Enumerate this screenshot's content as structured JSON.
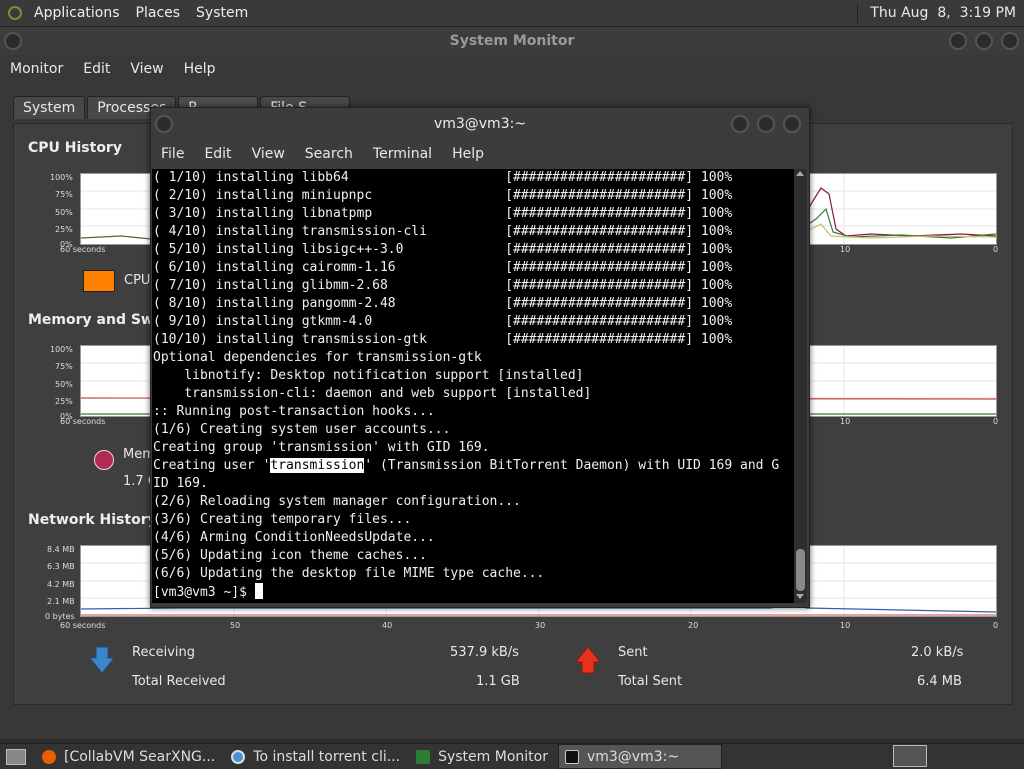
{
  "top_panel": {
    "menus": [
      "Applications",
      "Places",
      "System"
    ],
    "clock": "Thu Aug  8,  3:19 PM"
  },
  "sysmon": {
    "title": "System Monitor",
    "menu": [
      "Monitor",
      "Edit",
      "View",
      "Help"
    ],
    "tabs": [
      "System",
      "Processes",
      "R",
      "File S"
    ],
    "cpu": {
      "title": "CPU History",
      "y_ticks": [
        "100%",
        "75%",
        "50%",
        "25%",
        "0%"
      ],
      "x_start": "60 seconds",
      "x_visible": [
        "10",
        "0"
      ],
      "legend": "CPU"
    },
    "memory": {
      "title": "Memory and Swap H",
      "y_ticks": [
        "100%",
        "75%",
        "50%",
        "25%",
        "0%"
      ],
      "x_start": "60 seconds",
      "x_visible": [
        "10",
        "0"
      ],
      "legend_label": "Mem",
      "legend_value": "1.7 G"
    },
    "network": {
      "title": "Network History",
      "y_ticks": [
        "8.4 MB",
        "6.3 MB",
        "4.2 MB",
        "2.1 MB",
        "0 bytes"
      ],
      "x_ticks": [
        "60 seconds",
        "50",
        "40",
        "30",
        "20",
        "10",
        "0"
      ],
      "receiving_label": "Receiving",
      "receiving_value": "537.9 kB/s",
      "total_received_label": "Total Received",
      "total_received_value": "1.1 GB",
      "sent_label": "Sent",
      "sent_value": "2.0 kB/s",
      "total_sent_label": "Total Sent",
      "total_sent_value": "6.4 MB"
    }
  },
  "terminal": {
    "title": "vm3@vm3:~",
    "menu": [
      "File",
      "Edit",
      "View",
      "Search",
      "Terminal",
      "Help"
    ],
    "lines": [
      "( 1/10) installing libb64                    [######################] 100%",
      "( 2/10) installing miniupnpc                 [######################] 100%",
      "( 3/10) installing libnatpmp                 [######################] 100%",
      "( 4/10) installing transmission-cli          [######################] 100%",
      "( 5/10) installing libsigc++-3.0             [######################] 100%",
      "( 6/10) installing cairomm-1.16              [######################] 100%",
      "( 7/10) installing glibmm-2.68               [######################] 100%",
      "( 8/10) installing pangomm-2.48              [######################] 100%",
      "( 9/10) installing gtkmm-4.0                 [######################] 100%",
      "(10/10) installing transmission-gtk          [######################] 100%",
      "Optional dependencies for transmission-gtk",
      "    libnotify: Desktop notification support [installed]",
      "    transmission-cli: daemon and web support [installed]",
      ":: Running post-transaction hooks...",
      "(1/6) Creating system user accounts...",
      "Creating group 'transmission' with GID 169."
    ],
    "user_line_prefix": "Creating user '",
    "user_line_highlight": "transmission",
    "user_line_suffix": "' (Transmission BitTorrent Daemon) with UID 169 and G",
    "lines2": [
      "ID 169.",
      "(2/6) Reloading system manager configuration...",
      "(3/6) Creating temporary files...",
      "(4/6) Arming ConditionNeedsUpdate...",
      "(5/6) Updating icon theme caches...",
      "(6/6) Updating the desktop file MIME type cache..."
    ],
    "prompt": "[vm3@vm3 ~]$ "
  },
  "taskbar": {
    "tasks": [
      "[CollabVM SearXNG...",
      "To install torrent cli...",
      "System Monitor",
      "vm3@vm3:~"
    ]
  },
  "colors": {
    "cpu_legend": "#ff7f00",
    "receiving_arrow": "#3a86c8",
    "sent_arrow": "#e8321e"
  }
}
